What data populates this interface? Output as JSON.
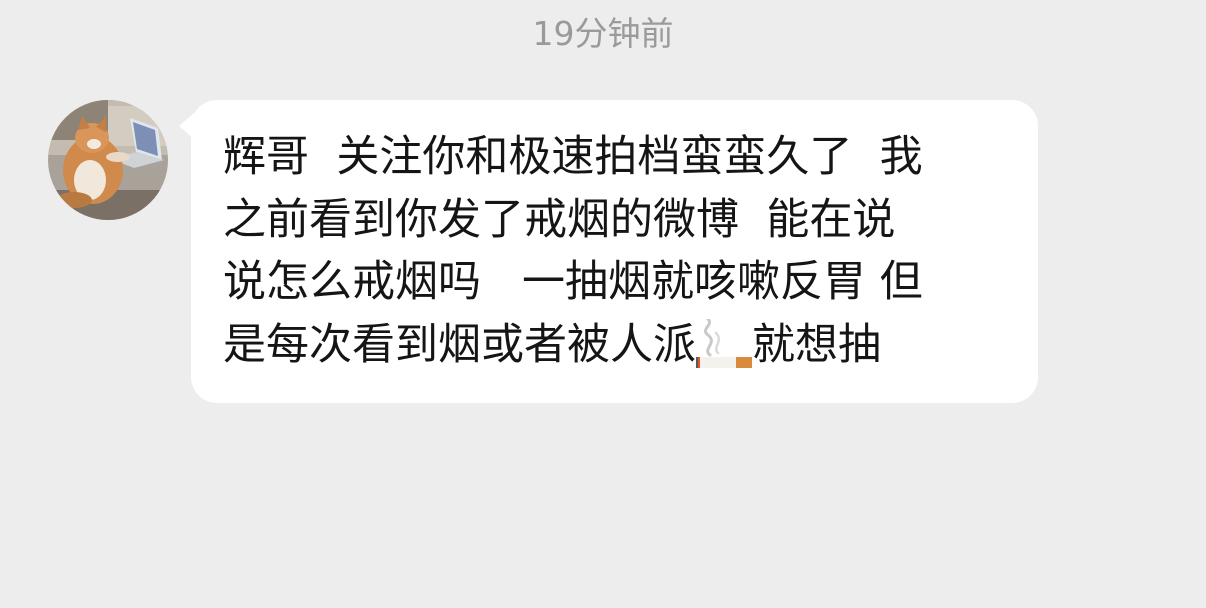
{
  "chat": {
    "timestamp": "19分钟前",
    "message": {
      "lines": [
        "辉哥  关注你和极速拍档蛮蛮久了  我",
        "之前看到你发了戒烟的微博  能在说",
        "说怎么戒烟吗   一抽烟就咳嗽反胃 但"
      ],
      "last_line_before_icon": "是每次看到烟或者被人派",
      "last_line_after_icon": "就想抽",
      "emoji": "cigarette-icon"
    },
    "avatar": "cat-at-laptop-avatar"
  },
  "colors": {
    "background": "#ededed",
    "bubble": "#ffffff",
    "text": "#151515",
    "timestamp": "#9a9a9a"
  }
}
